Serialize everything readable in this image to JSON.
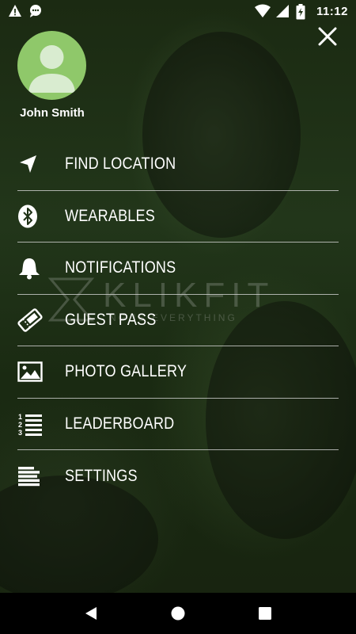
{
  "status_bar": {
    "time": "11:12",
    "left_icons": [
      "warning-icon",
      "chat-notification-icon"
    ],
    "right_icons": [
      "wifi-icon",
      "signal-icon",
      "battery-charging-icon"
    ]
  },
  "drawer": {
    "close_icon": "close-icon",
    "user": {
      "name": "John Smith",
      "avatar_icon": "person-placeholder-icon",
      "avatar_color": "#8fc86a"
    },
    "items": [
      {
        "label": "FIND LOCATION",
        "icon": "navigation-arrow-icon"
      },
      {
        "label": "WEARABLES",
        "icon": "bluetooth-icon"
      },
      {
        "label": "NOTIFICATIONS",
        "icon": "bell-icon"
      },
      {
        "label": "GUEST PASS",
        "icon": "ticket-icon"
      },
      {
        "label": "PHOTO GALLERY",
        "icon": "image-icon"
      },
      {
        "label": "LEADERBOARD",
        "icon": "numbered-list-icon"
      },
      {
        "label": "SETTINGS",
        "icon": "lines-icon"
      }
    ]
  },
  "watermark": {
    "title": "KLIKFIT",
    "tagline": "NG IS EVERYTHING"
  },
  "nav_bar": {
    "buttons": [
      "back-icon",
      "home-icon",
      "recents-icon"
    ]
  },
  "colors": {
    "background_tint": "#1f3216",
    "divider": "#dcdcdc",
    "text": "#ffffff"
  }
}
